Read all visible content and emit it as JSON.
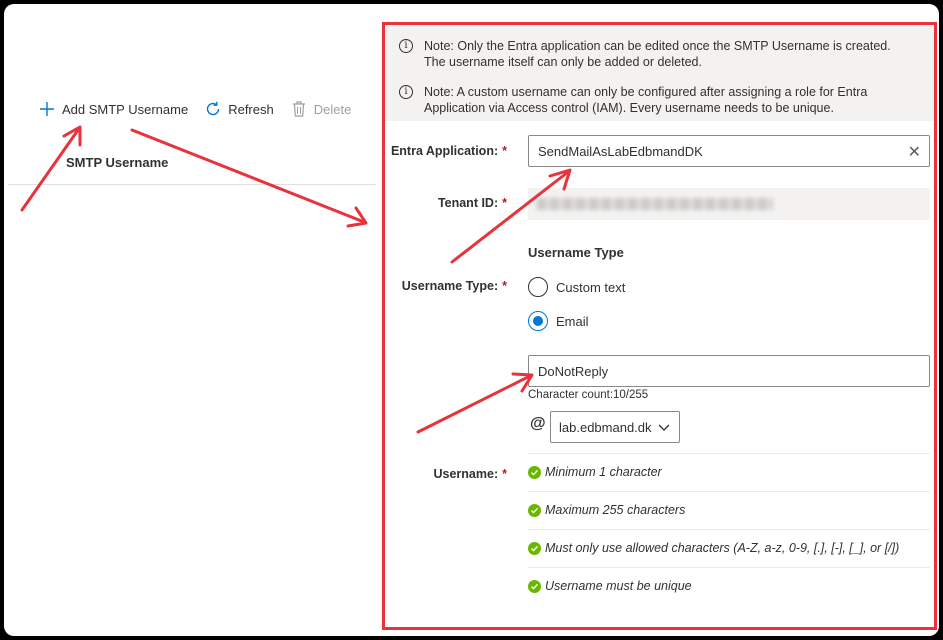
{
  "toolbar": {
    "add_label": "Add SMTP Username",
    "refresh_label": "Refresh",
    "delete_label": "Delete"
  },
  "list": {
    "column_header": "SMTP Username"
  },
  "notes": {
    "note1_line1": "Note: Only the Entra application can be edited once the SMTP Username is created.",
    "note1_line2": "The username itself can only be added or deleted.",
    "note2_line1": "Note: A custom username can only be configured after assigning a role for Entra",
    "note2_line2": "Application via Access control (IAM). Every username needs to be unique."
  },
  "form": {
    "entra_label": "Entra Application:",
    "entra_value": "SendMailAsLabEdbmandDK",
    "tenant_label": "Tenant ID:",
    "username_type_label": "Username Type:",
    "username_type_heading": "Username Type",
    "option_custom": "Custom text",
    "option_email": "Email",
    "selected_option": "Email",
    "username_label": "Username:",
    "username_value": "DoNotReply",
    "char_count": "Character count:10/255",
    "at_symbol": "@",
    "domain_value": "lab.edbmand.dk",
    "required_mark": "*"
  },
  "rules": [
    "Minimum 1 character",
    "Maximum 255 characters",
    "Must only use allowed characters (A-Z, a-z, 0-9, [.], [-], [_], or [/])",
    "Username must be unique"
  ],
  "colors": {
    "accent": "#0078d4",
    "annotation_red": "#e8323c",
    "success_green": "#6bb700"
  }
}
